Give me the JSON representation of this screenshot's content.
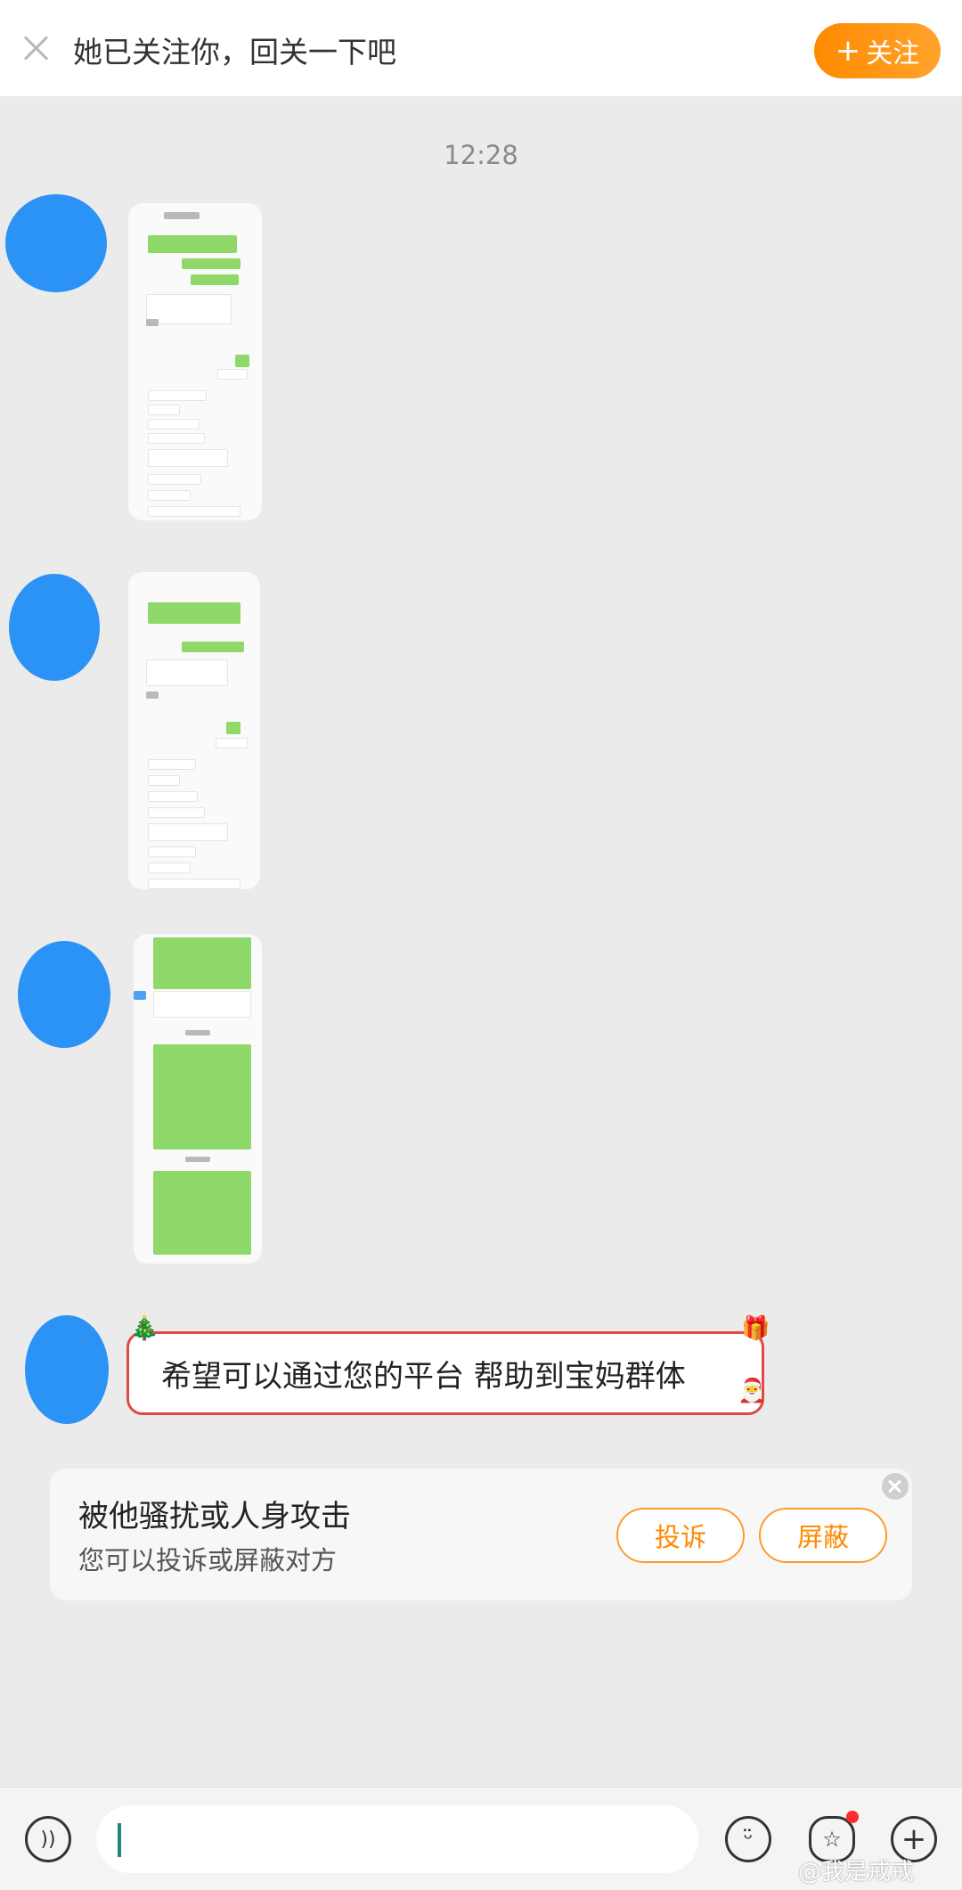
{
  "follow_bar": {
    "prompt": "她已关注你，回关一下吧",
    "follow_label": "关注",
    "follow_plus": "+"
  },
  "chat": {
    "timestamp": "12:28",
    "images": [
      "chat-screenshot-1",
      "chat-screenshot-2",
      "chat-screenshot-3"
    ],
    "message": "希望可以通过您的平台 帮助到宝妈群体"
  },
  "harass_card": {
    "title": "被他骚扰或人身攻击",
    "subtitle": "您可以投诉或屏蔽对方",
    "report_label": "投诉",
    "block_label": "屏蔽"
  },
  "input_bar": {
    "voice_icon": "voice-icon",
    "emoji_icon": "emoji-icon",
    "sticker_icon": "sticker-icon",
    "plus_icon": "plus-icon",
    "notification_color": "#ff2a2a"
  },
  "watermark": "@我是戒戒",
  "colors": {
    "accent": "#ff8a00",
    "avatar_blue": "#2b93f5",
    "bubble_border": "#e14a44"
  }
}
